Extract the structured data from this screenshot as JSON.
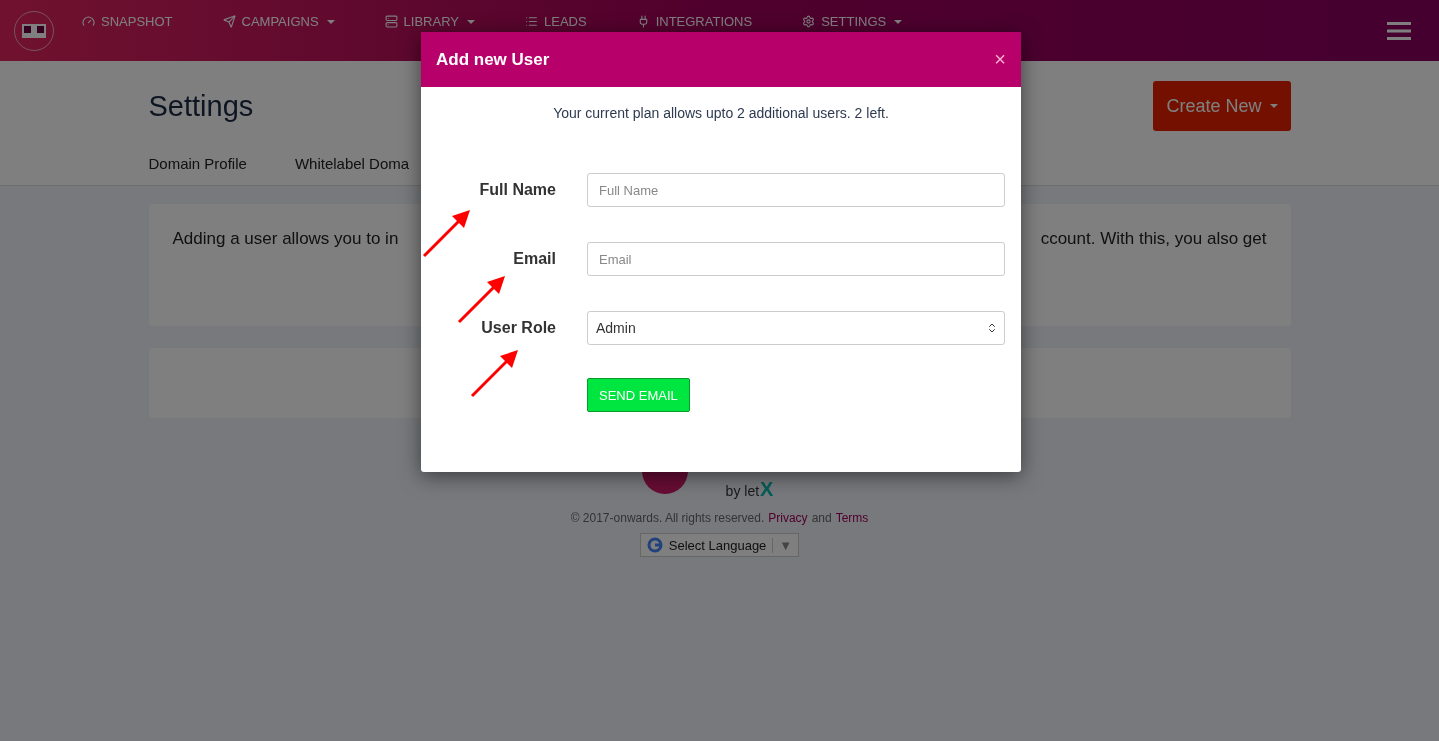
{
  "nav": {
    "items": [
      {
        "label": "SNAPSHOT",
        "dropdown": false
      },
      {
        "label": "CAMPAIGNS",
        "dropdown": true
      },
      {
        "label": "LIBRARY",
        "dropdown": true
      },
      {
        "label": "LEADS",
        "dropdown": false
      },
      {
        "label": "INTEGRATIONS",
        "dropdown": false
      },
      {
        "label": "SETTINGS",
        "dropdown": true
      }
    ]
  },
  "page": {
    "title": "Settings",
    "create_button": "Create New",
    "tabs": [
      "Domain Profile",
      "Whitelabel Doma"
    ],
    "info_start": "Adding a user allows you to in",
    "info_end": "ccount. With this, you also get"
  },
  "modal": {
    "title": "Add new User",
    "close": "×",
    "notice": "Your current plan allows upto 2 additional users. 2 left.",
    "fields": [
      {
        "kind": "text",
        "label": "Full Name",
        "placeholder": "Full Name"
      },
      {
        "kind": "text",
        "label": "Email",
        "placeholder": "Email"
      },
      {
        "kind": "select",
        "label": "User Role",
        "value": "Admin"
      }
    ],
    "submit": "SEND EMAIL"
  },
  "footer": {
    "by": "by let",
    "mark": "X",
    "copyright": "© 2017-onwards. All rights reserved.",
    "privacy": "Privacy",
    "and": "and",
    "terms": "Terms",
    "language": "Select Language",
    "language_arrow": "▼"
  }
}
